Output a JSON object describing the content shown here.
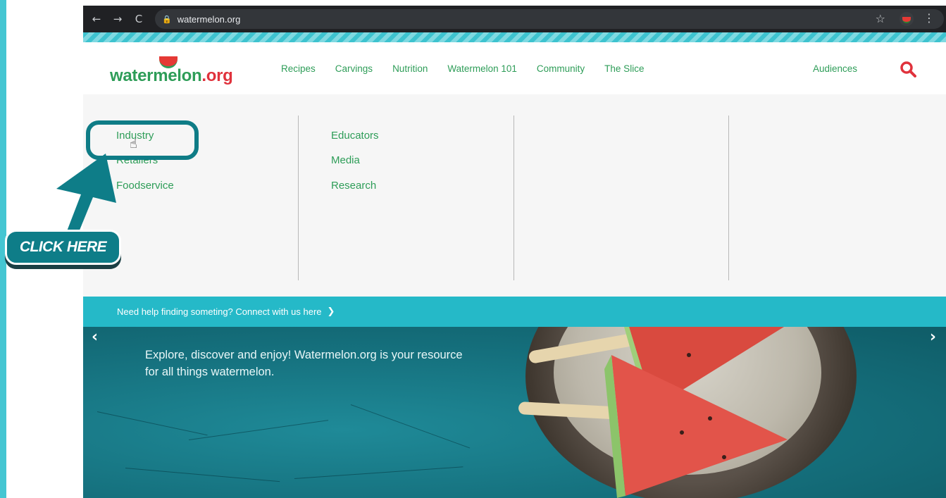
{
  "browser": {
    "url": "watermelon.org",
    "back": "←",
    "forward": "→",
    "reload": "C",
    "lock": "🔒",
    "star": "☆",
    "menu": "⋮"
  },
  "header": {
    "logo_main": "watermelon",
    "logo_suffix": ".org",
    "nav": [
      "Recipes",
      "Carvings",
      "Nutrition",
      "Watermelon 101",
      "Community",
      "The Slice"
    ],
    "audiences": "Audiences"
  },
  "dropdown": {
    "column1": [
      "Industry",
      "Retailers",
      "Foodservice"
    ],
    "column2": [
      "Educators",
      "Media",
      "Research"
    ]
  },
  "help_bar": {
    "text": "Need help finding someting? Connect with us here",
    "chevron": "❯"
  },
  "hero": {
    "text": "Explore, discover and enjoy! Watermelon.org is your resource for all things watermelon.",
    "prev": "‹",
    "next": "›"
  },
  "overlay": {
    "callout": "CLICK HERE",
    "cursor": "☝"
  },
  "colors": {
    "brand_green": "#2e9d58",
    "brand_red": "#e0323c",
    "teal": "#25b9c8",
    "overlay_teal": "#0e7d88"
  }
}
